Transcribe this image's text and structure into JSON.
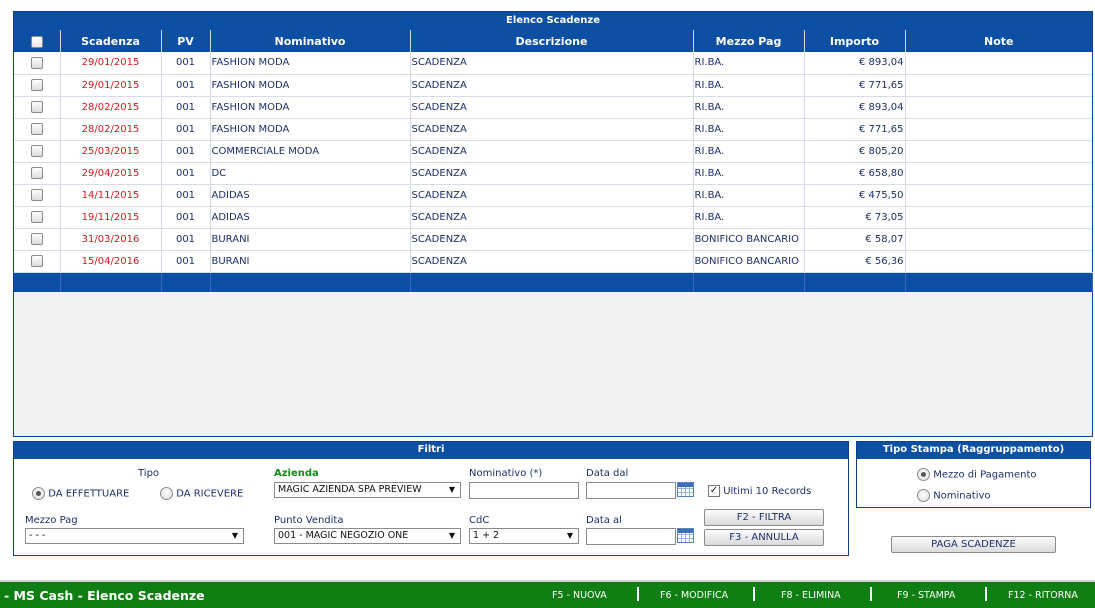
{
  "list": {
    "title": "Elenco Scadenze",
    "columns": [
      "Scadenza",
      "PV",
      "Nominativo",
      "Descrizione",
      "Mezzo Pag",
      "Importo",
      "Note"
    ],
    "rows": [
      {
        "scadenza": "29/01/2015",
        "pv": "001",
        "nominativo": "FASHION MODA",
        "descrizione": "SCADENZA",
        "mezzo": "RI.BA.",
        "importo": "€ 893,04",
        "note": ""
      },
      {
        "scadenza": "29/01/2015",
        "pv": "001",
        "nominativo": "FASHION MODA",
        "descrizione": "SCADENZA",
        "mezzo": "RI.BA.",
        "importo": "€ 771,65",
        "note": ""
      },
      {
        "scadenza": "28/02/2015",
        "pv": "001",
        "nominativo": "FASHION MODA",
        "descrizione": "SCADENZA",
        "mezzo": "RI.BA.",
        "importo": "€ 893,04",
        "note": ""
      },
      {
        "scadenza": "28/02/2015",
        "pv": "001",
        "nominativo": "FASHION MODA",
        "descrizione": "SCADENZA",
        "mezzo": "RI.BA.",
        "importo": "€ 771,65",
        "note": ""
      },
      {
        "scadenza": "25/03/2015",
        "pv": "001",
        "nominativo": "COMMERCIALE MODA",
        "descrizione": "SCADENZA",
        "mezzo": "RI.BA.",
        "importo": "€ 805,20",
        "note": ""
      },
      {
        "scadenza": "29/04/2015",
        "pv": "001",
        "nominativo": "DC",
        "descrizione": "SCADENZA",
        "mezzo": "RI.BA.",
        "importo": "€ 658,80",
        "note": ""
      },
      {
        "scadenza": "14/11/2015",
        "pv": "001",
        "nominativo": "ADIDAS",
        "descrizione": "SCADENZA",
        "mezzo": "RI.BA.",
        "importo": "€ 475,50",
        "note": ""
      },
      {
        "scadenza": "19/11/2015",
        "pv": "001",
        "nominativo": "ADIDAS",
        "descrizione": "SCADENZA",
        "mezzo": "RI.BA.",
        "importo": "€ 73,05",
        "note": ""
      },
      {
        "scadenza": "31/03/2016",
        "pv": "001",
        "nominativo": "BURANI",
        "descrizione": "SCADENZA",
        "mezzo": "BONIFICO BANCARIO",
        "importo": "€ 58,07",
        "note": ""
      },
      {
        "scadenza": "15/04/2016",
        "pv": "001",
        "nominativo": "BURANI",
        "descrizione": "SCADENZA",
        "mezzo": "BONIFICO BANCARIO",
        "importo": "€ 56,36",
        "note": ""
      }
    ]
  },
  "filtri": {
    "title": "Filtri",
    "tipo_label": "Tipo",
    "tipo_options": [
      "DA EFFETTUARE",
      "DA RICEVERE"
    ],
    "tipo_selected": "DA EFFETTUARE",
    "mezzo_pag_label": "Mezzo Pag",
    "mezzo_pag_value": "- - -",
    "azienda_label": "Azienda",
    "azienda_value": "MAGIC AZIENDA SPA PREVIEW",
    "punto_vendita_label": "Punto Vendita",
    "punto_vendita_value": "001 - MAGIC NEGOZIO ONE",
    "nominativo_label": "Nominativo (*)",
    "nominativo_value": "",
    "cdc_label": "CdC",
    "cdc_value": "1 + 2",
    "data_dal_label": "Data dal",
    "data_dal_value": "",
    "data_al_label": "Data al",
    "data_al_value": "",
    "ultimi_label": "Ultimi 10 Records",
    "ultimi_checked": true,
    "filtra_label": "F2 - FILTRA",
    "annulla_label": "F3 - ANNULLA"
  },
  "tipo_stampa": {
    "title": "Tipo Stampa (Raggruppamento)",
    "options": [
      "Mezzo di Pagamento",
      "Nominativo"
    ],
    "selected": "Mezzo di Pagamento"
  },
  "paga_label": "PAGA SCADENZE",
  "bottom_bar": {
    "title": "- MS Cash - Elenco Scadenze",
    "keys": [
      "F5 - NUOVA",
      "F6 - MODIFICA",
      "F8 - ELIMINA",
      "F9 - STAMPA",
      "F12 - RITORNA"
    ]
  },
  "colors": {
    "header_blue": "#0d4fa2",
    "date_red": "#d2191d",
    "bar_green": "#0f7f14",
    "label_green": "#128a12"
  }
}
